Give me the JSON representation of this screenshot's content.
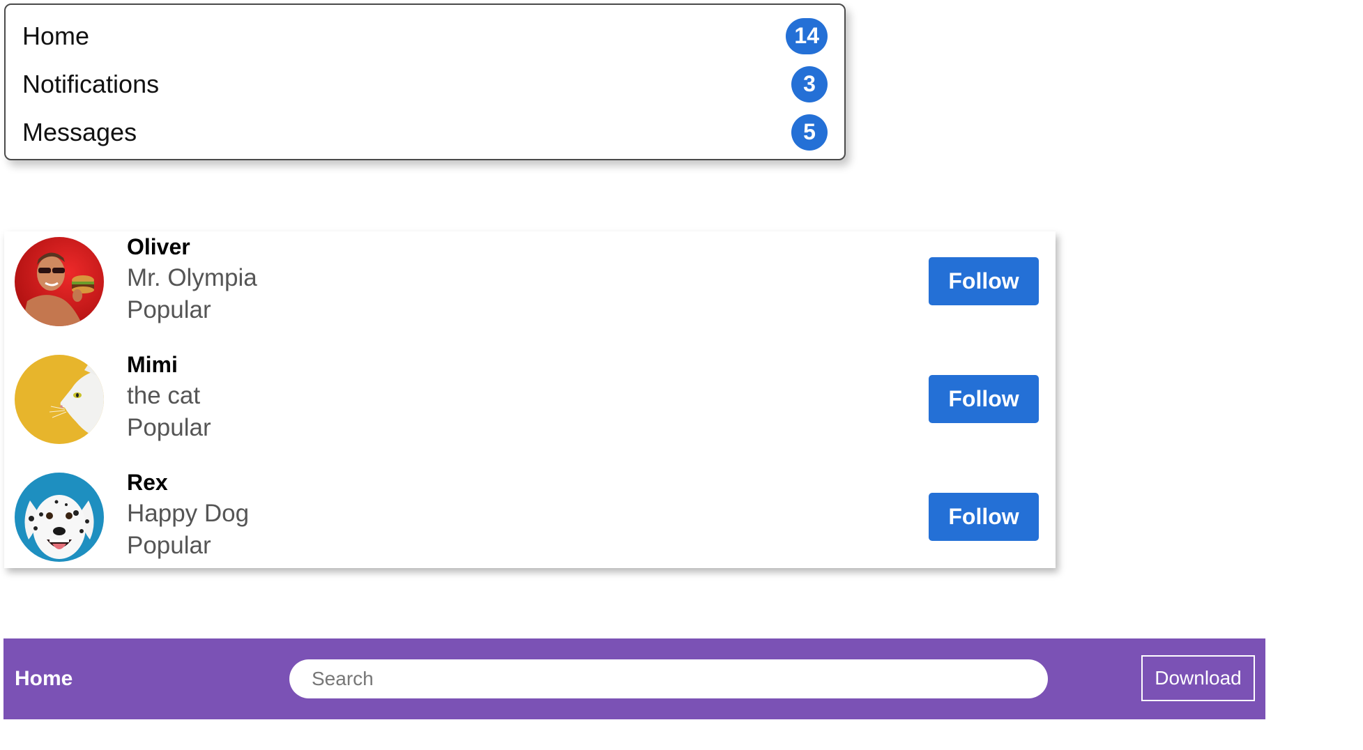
{
  "badge_list": {
    "items": [
      {
        "label": "Home",
        "count": "14"
      },
      {
        "label": "Notifications",
        "count": "3"
      },
      {
        "label": "Messages",
        "count": "5"
      }
    ]
  },
  "follow_list": {
    "users": [
      {
        "name": "Oliver",
        "subtitle": "Mr. Olympia",
        "tag": "Popular",
        "button": "Follow",
        "avatar": "man-with-burger-avatar"
      },
      {
        "name": "Mimi",
        "subtitle": "the cat",
        "tag": "Popular",
        "button": "Follow",
        "avatar": "white-cat-avatar"
      },
      {
        "name": "Rex",
        "subtitle": "Happy Dog",
        "tag": "Popular",
        "button": "Follow",
        "avatar": "dalmatian-dog-avatar"
      }
    ]
  },
  "navbar": {
    "home_label": "Home",
    "search_placeholder": "Search",
    "download_label": "Download"
  },
  "colors": {
    "accent_blue": "#2470d6",
    "navbar_purple": "#7b52b5"
  }
}
